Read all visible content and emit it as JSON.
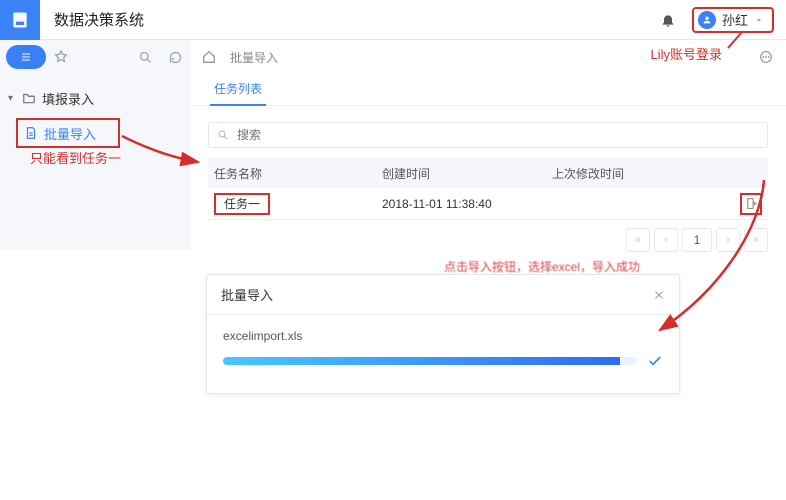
{
  "app_title": "数据决策系统",
  "user": {
    "name": "孙红"
  },
  "sidebar": {
    "root_label": "填报录入",
    "child_label": "批量导入"
  },
  "crumb": {
    "label": "批量导入"
  },
  "tabs": {
    "active": "任务列表"
  },
  "search": {
    "placeholder": "搜索"
  },
  "table": {
    "headers": {
      "name": "任务名称",
      "created": "创建时间",
      "modified": "上次修改时间"
    },
    "rows": [
      {
        "name": "任务一",
        "created": "2018-11-01 11:38:40",
        "modified": ""
      }
    ],
    "page": "1"
  },
  "modal": {
    "title": "批量导入",
    "filename": "excelimport.xls"
  },
  "annotations": {
    "login": "Lily账号登录",
    "only_one": "只能看到任务一",
    "modal_hint": "点击导入按钮，选择excel，导入成功"
  }
}
